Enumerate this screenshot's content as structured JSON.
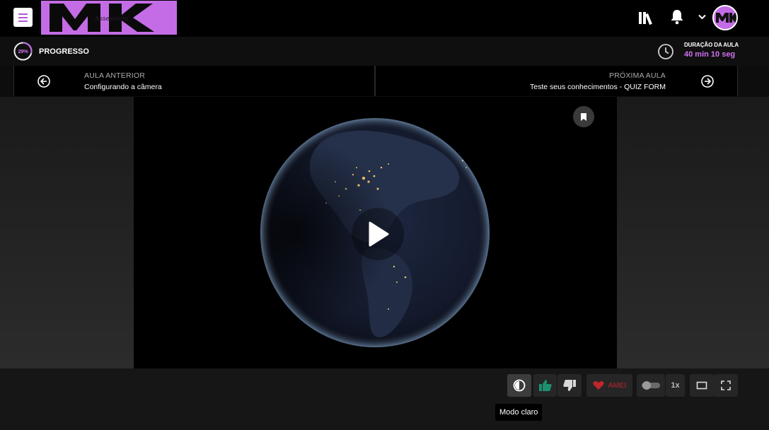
{
  "header": {
    "menu_icon": "hamburger-icon",
    "logo_text": "MK",
    "logo_subtext": "Assessoria",
    "icons": [
      "library-icon",
      "bell-icon",
      "chevron-down-icon"
    ],
    "avatar_text": "MK"
  },
  "progress": {
    "percent": 29,
    "percent_label": "29%",
    "label": "PROGRESSO",
    "duration_label": "DURAÇÃO DA AULA",
    "duration_value": "40 min 10 seg"
  },
  "lesson_nav": {
    "prev_label": "AULA ANTERIOR",
    "prev_title": "Configurando a câmera",
    "next_label": "PRÓXIMA AULA",
    "next_title": "Teste seus conhecimentos - QUIZ FORM"
  },
  "video": {
    "play_icon": "play-icon",
    "bookmark_icon": "bookmark-icon"
  },
  "controls": {
    "mode_icon": "contrast-icon",
    "like_icon": "thumbs-up-icon",
    "dislike_icon": "thumbs-down-icon",
    "love_label": "AMEI",
    "toggle_icon": "toggle-icon",
    "speed_label": "1x",
    "theater_icon": "theater-mode-icon",
    "fullscreen_icon": "fullscreen-icon",
    "tooltip": "Modo claro"
  },
  "colors": {
    "accent": "#c46ce6",
    "like": "#1c8f6f",
    "love": "#c0262a"
  }
}
